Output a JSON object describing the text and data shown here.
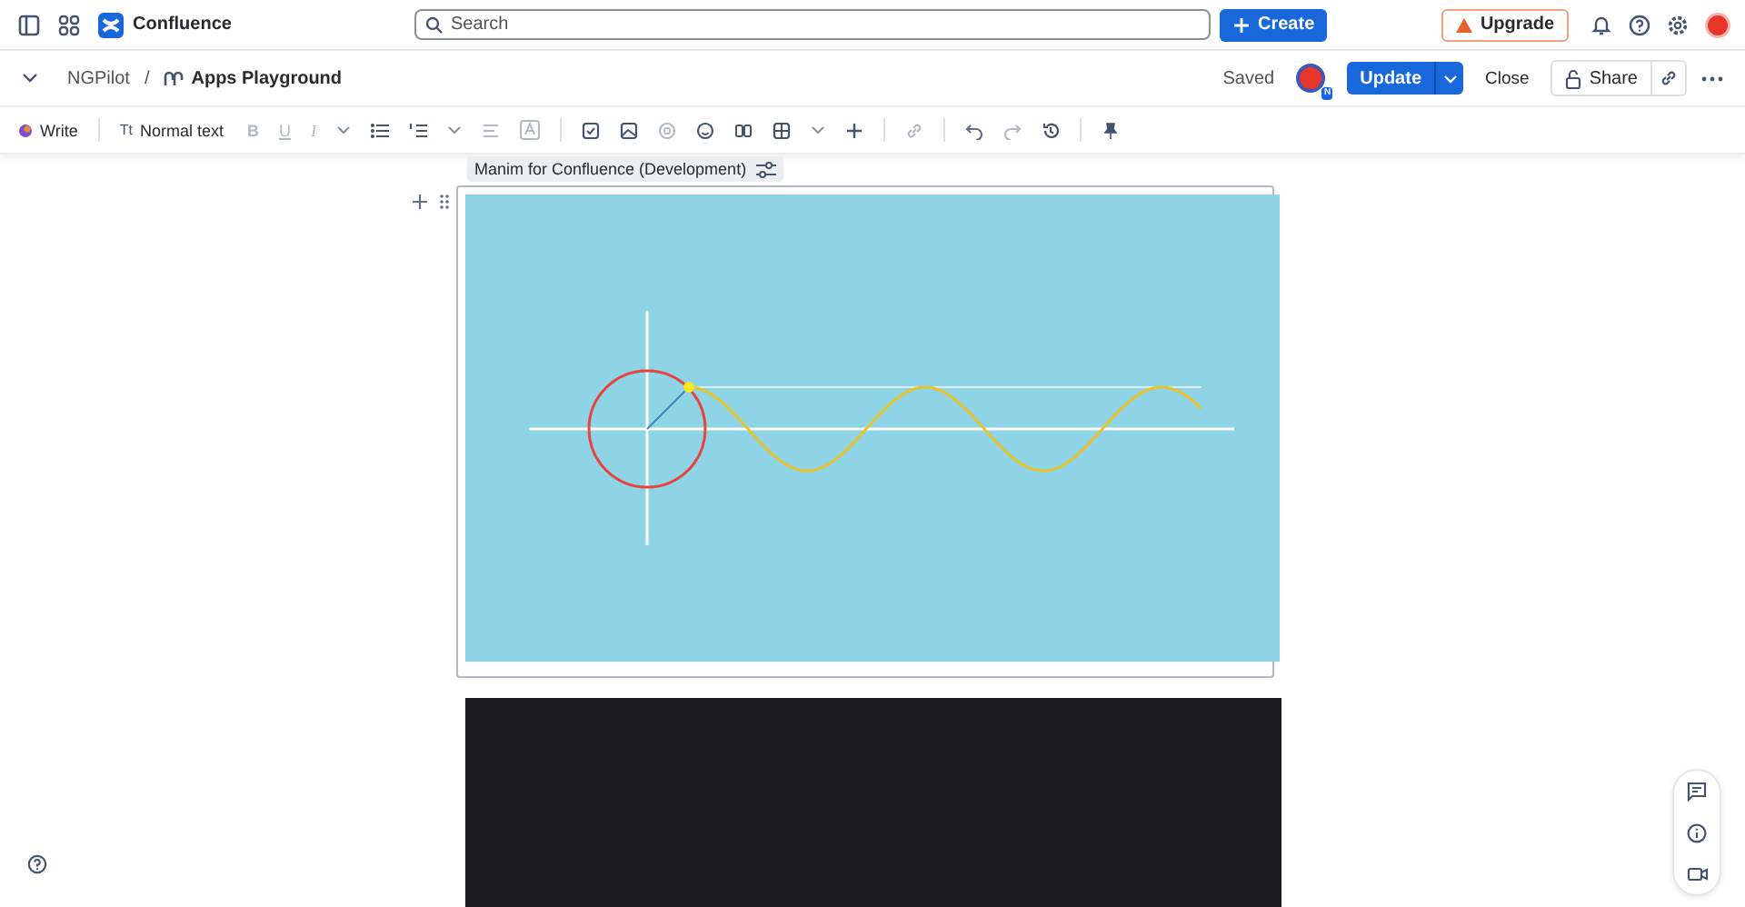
{
  "topbar": {
    "product": "Confluence",
    "search": {
      "placeholder": "Search"
    },
    "create": "Create",
    "upgrade": "Upgrade"
  },
  "breadcrumb": {
    "space": "NGPilot",
    "separator": "/",
    "page": "Apps Playground",
    "status": "Saved",
    "avatar_badge": "N",
    "update": "Update",
    "close": "Close",
    "share": "Share"
  },
  "toolbar": {
    "write": "Write",
    "text_style_glyph": "Tt",
    "text_style": "Normal text",
    "format_marks": [
      "B",
      "U",
      "I"
    ]
  },
  "macro": {
    "title": "Manim for Confluence (Development)"
  }
}
